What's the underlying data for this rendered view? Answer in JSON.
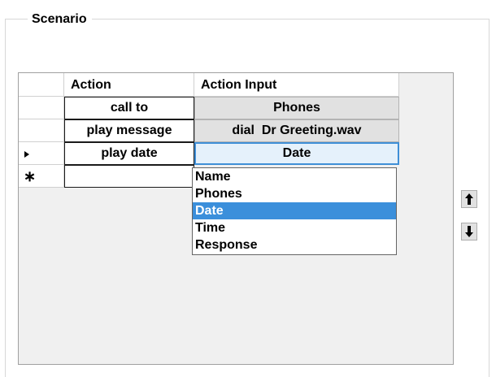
{
  "group": {
    "title": "Scenario"
  },
  "grid": {
    "columns": [
      "Action",
      "Action Input"
    ],
    "rows": [
      {
        "marker": "",
        "action": "call to",
        "input": "Phones"
      },
      {
        "marker": "",
        "action": "play message",
        "input": "dial  Dr Greeting.wav"
      },
      {
        "marker": "current-row-arrow",
        "action": "play date",
        "input": "Date"
      },
      {
        "marker": "new-row-asterisk",
        "action": "",
        "input": ""
      }
    ]
  },
  "dropdown": {
    "options": [
      "Name",
      "Phones",
      "Date",
      "Time",
      "Response"
    ],
    "selected": "Date"
  },
  "side_buttons": {
    "up_icon": "arrow-up-icon",
    "down_icon": "arrow-down-icon"
  },
  "colors": {
    "selection": "#3b8fdb",
    "active_cell_border": "#3f8fd7",
    "cell_button": "#e1e1e1"
  }
}
